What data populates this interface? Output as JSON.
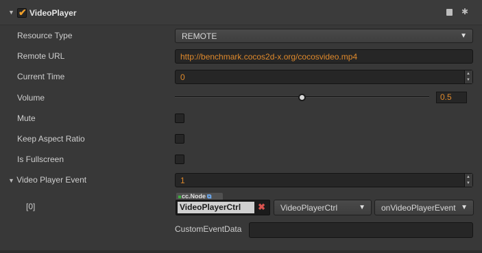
{
  "component": {
    "title": "VideoPlayer",
    "enabled": true,
    "icons": {
      "fold": "triangle-down-icon",
      "help": "book-icon",
      "settings": "gear-icon"
    }
  },
  "props": {
    "resource_type": {
      "label": "Resource Type",
      "value": "REMOTE"
    },
    "remote_url": {
      "label": "Remote URL",
      "value": "http://benchmark.cocos2d-x.org/cocosvideo.mp4"
    },
    "current_time": {
      "label": "Current Time",
      "value": "0"
    },
    "volume": {
      "label": "Volume",
      "value": "0.5",
      "level": 0.5
    },
    "mute": {
      "label": "Mute",
      "checked": false
    },
    "keep_aspect": {
      "label": "Keep Aspect Ratio",
      "checked": false
    },
    "fullscreen": {
      "label": "Is Fullscreen",
      "checked": false
    },
    "event": {
      "label": "Video Player Event",
      "count": "1"
    }
  },
  "event_item": {
    "index": "[0]",
    "node_type": "cc.Node",
    "node_value": "VideoPlayerCtrl",
    "component": "VideoPlayerCtrl",
    "handler": "onVideoPlayerEvent",
    "custom_label": "CustomEventData",
    "custom_value": ""
  },
  "colors": {
    "accent": "#e08a2c",
    "background": "#383838",
    "field": "#262626"
  }
}
